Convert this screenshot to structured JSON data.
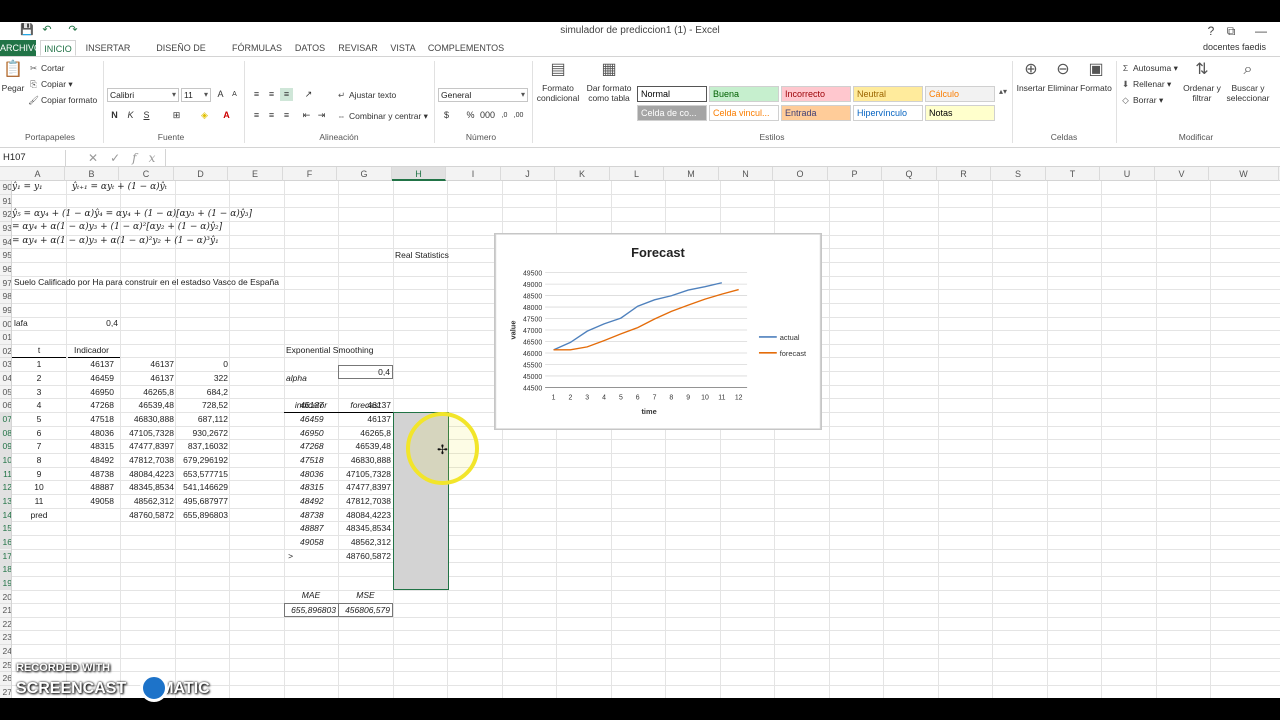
{
  "window": {
    "title": "simulador de prediccion1 (1) - Excel",
    "user": "docentes faedis",
    "help": "?",
    "restore": "⧉",
    "minimize": "—",
    "maximize": "☐",
    "close": "✕"
  },
  "quick_access": {
    "save": "💾",
    "undo": "↶",
    "redo": "↷"
  },
  "tabs": [
    "ARCHIVO",
    "INICIO",
    "INSERTAR",
    "DISEÑO DE PÁGINA",
    "FÓRMULAS",
    "DATOS",
    "REVISAR",
    "VISTA",
    "COMPLEMENTOS"
  ],
  "ribbon": {
    "clipboard": {
      "paste": "Pegar",
      "cut": "Cortar",
      "copy": "Copiar",
      "format_painter": "Copiar formato",
      "label": "Portapapeles"
    },
    "font": {
      "name": "Calibri",
      "size": "11",
      "bold": "N",
      "italic": "K",
      "underline": "S",
      "label": "Fuente"
    },
    "alignment": {
      "wrap": "Ajustar texto",
      "merge": "Combinar y centrar",
      "label": "Alineación"
    },
    "number": {
      "format": "General",
      "label": "Número"
    },
    "styles": {
      "cond_format": "Formato condicional",
      "table_format": "Dar formato como tabla",
      "items": [
        {
          "label": "Normal",
          "bg": "#ffffff",
          "fg": "#000000"
        },
        {
          "label": "Buena",
          "bg": "#c6efce",
          "fg": "#006100"
        },
        {
          "label": "Incorrecto",
          "bg": "#ffc7ce",
          "fg": "#9c0006"
        },
        {
          "label": "Neutral",
          "bg": "#ffeb9c",
          "fg": "#9c6500"
        },
        {
          "label": "Cálculo",
          "bg": "#f2f2f2",
          "fg": "#fa7d00"
        },
        {
          "label": "Celda de co...",
          "bg": "#a5a5a5",
          "fg": "#ffffff"
        },
        {
          "label": "Celda vincul...",
          "bg": "#ffffff",
          "fg": "#fa7d00"
        },
        {
          "label": "Entrada",
          "bg": "#ffcc99",
          "fg": "#3f3f76"
        },
        {
          "label": "Hipervínculo",
          "bg": "#ffffff",
          "fg": "#0563c1"
        },
        {
          "label": "Notas",
          "bg": "#ffffcc",
          "fg": "#000000"
        }
      ],
      "label": "Estilos"
    },
    "cells": {
      "insert": "Insertar",
      "delete": "Eliminar",
      "format": "Formato",
      "label": "Celdas"
    },
    "editing": {
      "autosum": "Autosuma",
      "fill": "Rellenar",
      "clear": "Borrar",
      "sort": "Ordenar y filtrar",
      "find": "Buscar y seleccionar",
      "label": "Modificar"
    }
  },
  "formula_bar": {
    "name_box": "H107",
    "fx": "fx",
    "formula": ""
  },
  "columns": [
    "A",
    "B",
    "C",
    "D",
    "E",
    "F",
    "G",
    "H",
    "I",
    "J",
    "K",
    "L",
    "M",
    "N",
    "O",
    "P",
    "Q",
    "R",
    "S",
    "T",
    "U",
    "V",
    "W"
  ],
  "selected_column": "H",
  "rows": [
    "90",
    "91",
    "92",
    "93",
    "94",
    "95",
    "96",
    "97",
    "98",
    "99",
    "00",
    "01",
    "02",
    "03",
    "04",
    "05",
    "06",
    "07",
    "08",
    "09",
    "10",
    "11",
    "12",
    "13",
    "14",
    "15",
    "16",
    "17",
    "18",
    "19",
    "20",
    "21",
    "22",
    "23",
    "24",
    "25",
    "26",
    "27",
    "28"
  ],
  "selected_rows": [
    "07",
    "08",
    "09",
    "10",
    "11",
    "12",
    "13",
    "14",
    "15",
    "16",
    "17",
    "18",
    "19"
  ],
  "formulas": {
    "f90a": "ŷ₁ = y₁",
    "f90b": "ŷₜ₊₁ = αyₜ + (1 − α)ŷₜ",
    "f92": "ŷ₅ = αy₄ + (1 − α)ŷ₄ = αy₄ + (1 − α)[αy₃ + (1 − α)ŷ₃]",
    "f93": "= αy₄ + α(1 − α)y₃ + (1 − α)²[αy₂ + (1 − α)ŷ₂]",
    "f94": "= αy₄ + α(1 − α)y₃ + α(1 − α)²y₂ + (1 − α)³ŷ₁"
  },
  "sheet": {
    "real_stats": "Real Statistics",
    "description": "Suelo Calificado por Ha para construir en el estadso Vasco de España",
    "alfa_label": "lafa",
    "alfa_value": "0,4",
    "hdr_t": "t",
    "hdr_ind": "Indicador",
    "d102": "0",
    "table": [
      {
        "t": "1",
        "ind": "46137",
        "c": "46137",
        "d": ""
      },
      {
        "t": "2",
        "ind": "46459",
        "c": "46137",
        "d": "322"
      },
      {
        "t": "3",
        "ind": "46950",
        "c": "46265,8",
        "d": "684,2"
      },
      {
        "t": "4",
        "ind": "47268",
        "c": "46539,48",
        "d": "728,52"
      },
      {
        "t": "5",
        "ind": "47518",
        "c": "46830,888",
        "d": "687,112"
      },
      {
        "t": "6",
        "ind": "48036",
        "c": "47105,7328",
        "d": "930,2672"
      },
      {
        "t": "7",
        "ind": "48315",
        "c": "47477,8397",
        "d": "837,16032"
      },
      {
        "t": "8",
        "ind": "48492",
        "c": "47812,7038",
        "d": "679,296192"
      },
      {
        "t": "9",
        "ind": "48738",
        "c": "48084,4223",
        "d": "653,577715"
      },
      {
        "t": "10",
        "ind": "48887",
        "c": "48345,8534",
        "d": "541,146629"
      },
      {
        "t": "11",
        "ind": "49058",
        "c": "48562,312",
        "d": "495,687977"
      },
      {
        "t": "pred",
        "ind": "",
        "c": "48760,5872",
        "d": "655,896803"
      }
    ],
    "es_title": "Exponential Smoothing",
    "es_alpha_label": "alpha",
    "es_alpha": "0,4",
    "es_hdr_ind": "indicator",
    "es_hdr_fc": "forecast",
    "es_rows": [
      {
        "ind": "46137",
        "fc": "46137"
      },
      {
        "ind": "46459",
        "fc": "46137"
      },
      {
        "ind": "46950",
        "fc": "46265,8"
      },
      {
        "ind": "47268",
        "fc": "46539,48"
      },
      {
        "ind": "47518",
        "fc": "46830,888"
      },
      {
        "ind": "48036",
        "fc": "47105,7328"
      },
      {
        "ind": "48315",
        "fc": "47477,8397"
      },
      {
        "ind": "48492",
        "fc": "47812,7038"
      },
      {
        "ind": "48738",
        "fc": "48084,4223"
      },
      {
        "ind": "48887",
        "fc": "48345,8534"
      },
      {
        "ind": "49058",
        "fc": "48562,312"
      },
      {
        "ind": ">",
        "fc": "48760,5872"
      }
    ],
    "mae_label": "MAE",
    "mse_label": "MSE",
    "mae": "655,896803",
    "mse": "456806,579"
  },
  "chart_data": {
    "type": "line",
    "title": "Forecast",
    "xlabel": "time",
    "ylabel": "value",
    "x": [
      1,
      2,
      3,
      4,
      5,
      6,
      7,
      8,
      9,
      10,
      11,
      12
    ],
    "ylim": [
      44500,
      49500
    ],
    "yticks": [
      44500,
      45000,
      45500,
      46000,
      46500,
      47000,
      47500,
      48000,
      48500,
      49000,
      49500
    ],
    "legend_position": "right",
    "series": [
      {
        "name": "actual",
        "color": "#4f81bd",
        "values": [
          46137,
          46459,
          46950,
          47268,
          47518,
          48036,
          48315,
          48492,
          48738,
          48887,
          49058,
          null
        ]
      },
      {
        "name": "forecast",
        "color": "#e46c0a",
        "values": [
          46137,
          46137,
          46265.8,
          46539.48,
          46830.888,
          47105.7328,
          47477.8397,
          47812.7038,
          48084.4223,
          48345.8534,
          48562.312,
          48760.5872
        ]
      }
    ]
  },
  "watermark": {
    "line1": "RECORDED WITH",
    "line2": "SCREENCAST",
    "line3": "MATIC"
  }
}
